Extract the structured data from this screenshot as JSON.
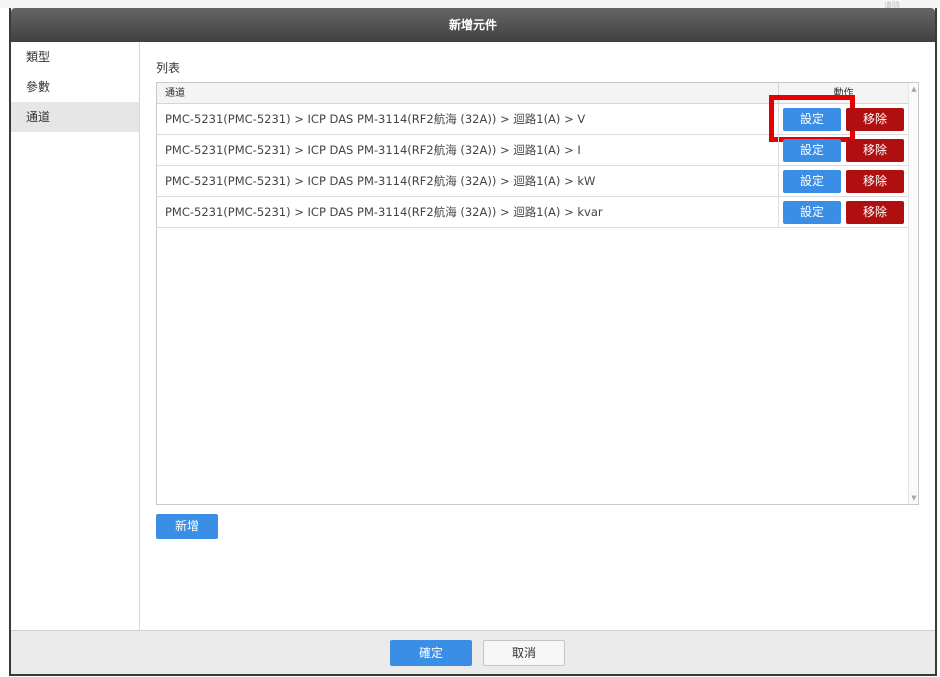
{
  "background": {
    "corner_text": "清除"
  },
  "dialog": {
    "title": "新增元件",
    "sidebar": {
      "items": [
        {
          "label": "類型",
          "active": false
        },
        {
          "label": "參數",
          "active": false
        },
        {
          "label": "通道",
          "active": true
        }
      ]
    },
    "main": {
      "section_title": "列表",
      "table": {
        "columns": [
          "通道",
          "動作"
        ],
        "rows": [
          {
            "channel": "PMC-5231(PMC-5231) > ICP DAS PM-3114(RF2航海 (32A)) > 迴路1(A) > V",
            "set_label": "設定",
            "remove_label": "移除"
          },
          {
            "channel": "PMC-5231(PMC-5231) > ICP DAS PM-3114(RF2航海 (32A)) > 迴路1(A) > I",
            "set_label": "設定",
            "remove_label": "移除"
          },
          {
            "channel": "PMC-5231(PMC-5231) > ICP DAS PM-3114(RF2航海 (32A)) > 迴路1(A) > kW",
            "set_label": "設定",
            "remove_label": "移除"
          },
          {
            "channel": "PMC-5231(PMC-5231) > ICP DAS PM-3114(RF2航海 (32A)) > 迴路1(A) > kvar",
            "set_label": "設定",
            "remove_label": "移除"
          }
        ]
      },
      "add_button": "新增"
    },
    "footer": {
      "ok_button": "確定",
      "cancel_button": "取消"
    }
  },
  "colors": {
    "primary_button": "#3a8ee6",
    "danger_button": "#b00f0f",
    "highlight_box": "#e60000",
    "titlebar": "#4a4a4a"
  },
  "icons": {
    "scroll_up": "triangle-up-icon",
    "scroll_down": "triangle-down-icon"
  }
}
